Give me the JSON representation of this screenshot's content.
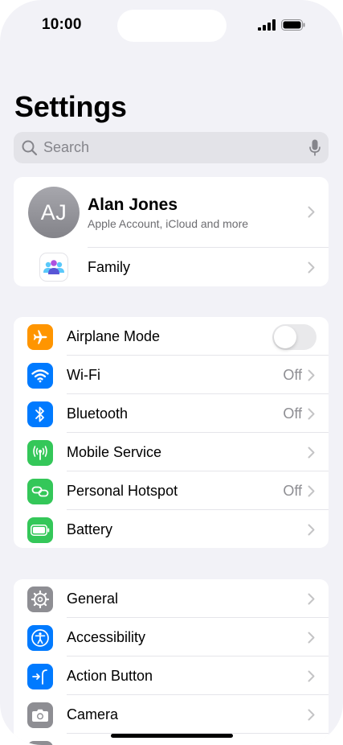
{
  "status_bar": {
    "time": "10:00"
  },
  "search": {
    "placeholder": "Search"
  },
  "page": {
    "title": "Settings"
  },
  "account": {
    "initials": "AJ",
    "name": "Alan Jones",
    "subtitle": "Apple Account, iCloud and more",
    "family_label": "Family"
  },
  "connectivity": {
    "airplane_label": "Airplane Mode",
    "airplane_on": false,
    "wifi_label": "Wi-Fi",
    "wifi_value": "Off",
    "bluetooth_label": "Bluetooth",
    "bluetooth_value": "Off",
    "mobile_label": "Mobile Service",
    "hotspot_label": "Personal Hotspot",
    "hotspot_value": "Off",
    "battery_label": "Battery"
  },
  "system": {
    "general_label": "General",
    "accessibility_label": "Accessibility",
    "action_button_label": "Action Button",
    "camera_label": "Camera"
  },
  "colors": {
    "background": "#f2f2f7",
    "airplane": "#ff9500",
    "wifi": "#007aff",
    "bluetooth": "#007aff",
    "mobile": "#34c759",
    "hotspot": "#34c759",
    "battery": "#34c759",
    "general": "#8e8e93",
    "accessibility": "#007aff",
    "action_button": "#007aff",
    "camera": "#8e8e93"
  },
  "icons": [
    "search-icon",
    "microphone-icon",
    "chevron-right-icon",
    "family-icon",
    "airplane-icon",
    "wifi-icon",
    "bluetooth-icon",
    "antenna-icon",
    "hotspot-link-icon",
    "battery-icon",
    "gear-icon",
    "accessibility-icon",
    "action-button-icon",
    "camera-icon"
  ]
}
